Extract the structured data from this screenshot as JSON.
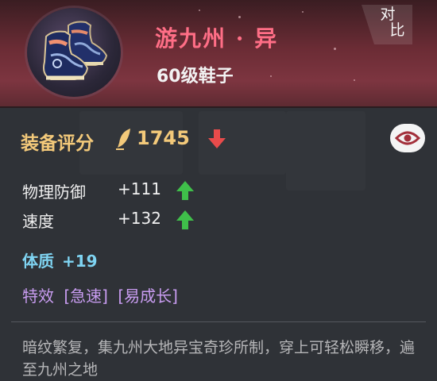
{
  "item": {
    "name": "游九州 · 异",
    "type": "60级鞋子",
    "icon": "shoes-icon"
  },
  "compare": {
    "label_1": "对",
    "label_2": "比"
  },
  "score": {
    "label": "装备评分",
    "value": "1745",
    "trend": "down",
    "color": "#f3c97a"
  },
  "stats": [
    {
      "label": "物理防御",
      "value": "+111",
      "trend": "up"
    },
    {
      "label": "速度",
      "value": "+132",
      "trend": "up"
    }
  ],
  "attribute": {
    "label": "体质",
    "value": "+19",
    "color": "#7fd4f2"
  },
  "effects": {
    "label": "特效",
    "tags": [
      "[急速]",
      "[易成长]"
    ],
    "color": "#c89cf0"
  },
  "description": "暗纹繁复，集九州大地异宝奇珍所制，穿上可轻松瞬移，遍至九州之地",
  "colors": {
    "name": "#ff6e86",
    "up_arrow": "#3fbf4a",
    "down_arrow": "#e84b4b",
    "header": "#6b2c35"
  }
}
